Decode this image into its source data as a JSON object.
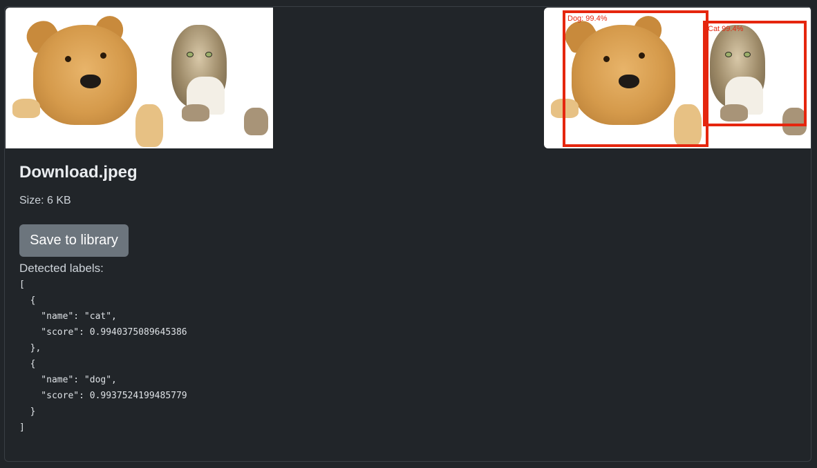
{
  "file": {
    "name": "Download.jpeg",
    "size_text": "Size: 6 KB"
  },
  "actions": {
    "save_label": "Save to library"
  },
  "detections": {
    "title": "Detected labels:",
    "json_text": "[\n  {\n    \"name\": \"cat\",\n    \"score\": 0.9940375089645386\n  },\n  {\n    \"name\": \"dog\",\n    \"score\": 0.9937524199485779\n  }\n]",
    "boxes": [
      {
        "label": "Dog: 99.4%"
      },
      {
        "label": "Cat 99.4%"
      }
    ]
  },
  "colors": {
    "background": "#212529",
    "button": "#6c757d",
    "box_stroke": "#e5260e"
  }
}
